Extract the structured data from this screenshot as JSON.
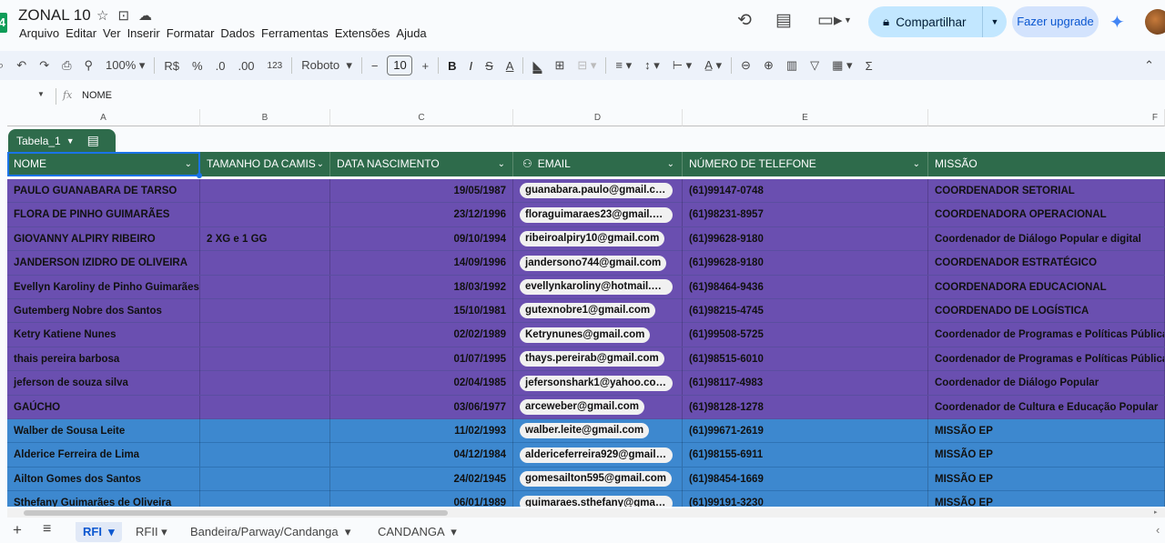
{
  "header": {
    "doc_title": "ZONAL 10",
    "menu": [
      "Arquivo",
      "Editar",
      "Ver",
      "Inserir",
      "Formatar",
      "Dados",
      "Ferramentas",
      "Extensões",
      "Ajuda"
    ],
    "share_label": "Compartilhar",
    "upgrade_label": "Fazer upgrade"
  },
  "toolbar": {
    "zoom": "100%",
    "currency": "R$",
    "percent": "%",
    "dec_decrease": ".0",
    "dec_increase": ".00",
    "format_123": "123",
    "font": "Roboto",
    "font_size": "10",
    "bold": "B",
    "italic": "I",
    "strike": "S",
    "text_color": "A",
    "function": "Σ"
  },
  "formula_bar": {
    "fx": "fx",
    "value": "NOME"
  },
  "columns": [
    "A",
    "B",
    "C",
    "D",
    "E",
    "F"
  ],
  "table": {
    "name": "Tabela_1",
    "headers": [
      "NOME",
      "TAMANHO DA CAMIS",
      "DATA NASCIMENTO",
      "EMAIL",
      "NÚMERO DE TELEFONE",
      "MISSÃO"
    ],
    "rows": [
      {
        "nome": "PAULO GUANABARA DE TARSO",
        "tamanho": "",
        "data": "19/05/1987",
        "email": "guanabara.paulo@gmail.com",
        "telefone": "(61)99147-0748",
        "missao": "COORDENADOR  SETORIAL"
      },
      {
        "nome": "FLORA DE PINHO GUIMARÃES",
        "tamanho": "",
        "data": "23/12/1996",
        "email": "floraguimaraes23@gmail.com",
        "telefone": "(61)98231-8957",
        "missao": "COORDENADORA  OPERACIONAL"
      },
      {
        "nome": "GIOVANNY ALPIRY RIBEIRO",
        "tamanho": "2 XG e 1 GG",
        "data": "09/10/1994",
        "email": "ribeiroalpiry10@gmail.com",
        "telefone": "(61)99628-9180",
        "missao": "Coordenador de Diálogo Popular e digital"
      },
      {
        "nome": "JANDERSON IZIDRO DE OLIVEIRA",
        "tamanho": "",
        "data": "14/09/1996",
        "email": "jandersono744@gmail.com",
        "telefone": "(61)99628-9180",
        "missao": "COORDENADOR  ESTRATÉGICO"
      },
      {
        "nome": "Evellyn Karoliny de Pinho Guimarães",
        "tamanho": "",
        "data": "18/03/1992",
        "email": "evellynkaroliny@hotmail.com",
        "telefone": "(61)98464-9436",
        "missao": "COORDENADORA EDUCACIONAL"
      },
      {
        "nome": "Gutemberg Nobre dos Santos",
        "tamanho": "",
        "data": "15/10/1981",
        "email": "gutexnobre1@gmail.com",
        "telefone": "(61)98215-4745",
        "missao": "COORDENADO DE LOGÍSTICA"
      },
      {
        "nome": "Ketry Katiene Nunes",
        "tamanho": "",
        "data": "02/02/1989",
        "email": "Ketrynunes@gmail.com",
        "telefone": "(61)99508-5725",
        "missao": "Coordenador de Programas e Políticas Públicas"
      },
      {
        "nome": "thais pereira barbosa",
        "tamanho": "",
        "data": "01/07/1995",
        "email": "thays.pereirab@gmail.com",
        "telefone": "(61)98515-6010",
        "missao": "Coordenador de Programas e Políticas Públicas"
      },
      {
        "nome": "jeferson de souza silva",
        "tamanho": "",
        "data": "02/04/1985",
        "email": "jefersonshark1@yahoo.com.br",
        "telefone": "(61)98117-4983",
        "missao": "Coordenador de Diálogo Popular"
      },
      {
        "nome": "GAÚCHO",
        "tamanho": "",
        "data": "03/06/1977",
        "email": "arceweber@gmail.com",
        "telefone": "(61)98128-1278",
        "missao": "Coordenador de Cultura e Educação Popular"
      },
      {
        "nome": "Walber de Sousa Leite",
        "tamanho": "",
        "data": "11/02/1993",
        "email": "walber.leite@gmail.com",
        "telefone": "(61)99671-2619",
        "missao": "MISSÃO EP"
      },
      {
        "nome": "Alderice Ferreira de Lima",
        "tamanho": "",
        "data": "04/12/1984",
        "email": "aldericeferreira929@gmail.c...",
        "telefone": "(61)98155-6911",
        "missao": "MISSÃO EP"
      },
      {
        "nome": "Ailton Gomes dos Santos",
        "tamanho": "",
        "data": "24/02/1945",
        "email": "gomesailton595@gmail.com",
        "telefone": "(61)98454-1669",
        "missao": "MISSÃO EP"
      },
      {
        "nome": "Sthefany Guimarães de Oliveira",
        "tamanho": "",
        "data": "06/01/1989",
        "email": "guimaraes.sthefany@gmail.c...",
        "telefone": "(61)99191-3230",
        "missao": "MISSÃO EP"
      }
    ],
    "row_colors": [
      "purple",
      "purple",
      "purple",
      "purple",
      "purple",
      "purple",
      "purple",
      "purple",
      "purple",
      "purple",
      "blue",
      "blue",
      "blue",
      "blue"
    ]
  },
  "sheets": [
    "RFI",
    "RFII",
    "Bandeira/Parway/Candanga",
    "CANDANGA"
  ],
  "active_sheet": "RFI",
  "colors": {
    "header_green": "#2e6b4b",
    "row_purple": "#6a4fb0",
    "row_blue": "#3d88cf",
    "share_bg": "#c2e7ff"
  }
}
